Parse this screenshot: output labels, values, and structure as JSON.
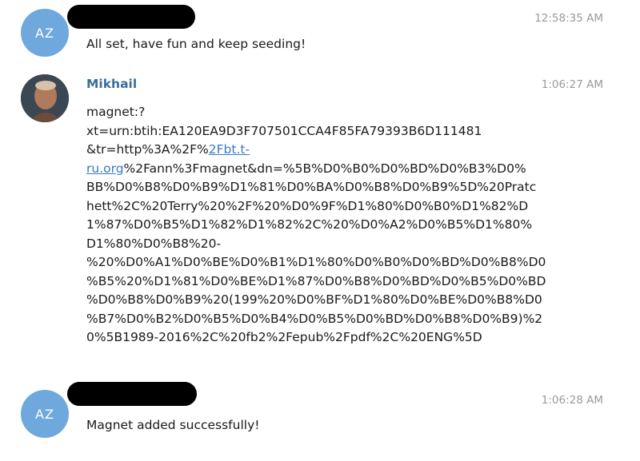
{
  "messages": [
    {
      "avatar_initials": "AZ",
      "sender_redacted": true,
      "time": "12:58:35 AM",
      "text": "All set, have fun and keep seeding!"
    },
    {
      "avatar_type": "photo",
      "sender": "Mikhail",
      "time": "1:06:27 AM",
      "magnet_line1": "magnet:?",
      "magnet_line2": "xt=urn:btih:EA120EA9D3F707501CCA4F85FA79393B6D111481",
      "magnet_line3_prefix": "&tr=http%3A%2F%",
      "magnet_link_part1": "2Fbt.t-",
      "magnet_link_part2": "ru.org",
      "magnet_line4_suffix": "%2Fann%3Fmagnet&dn=%5B%D0%B0%D0%BD%D0%B3%D0%",
      "magnet_rest": [
        "BB%D0%B8%D0%B9%D1%81%D0%BA%D0%B8%D0%B9%5D%20Pratc",
        "hett%2C%20Terry%20%2F%20%D0%9F%D1%80%D0%B0%D1%82%D",
        "1%87%D0%B5%D1%82%D1%82%2C%20%D0%A2%D0%B5%D1%80%",
        "D1%80%D0%B8%20-",
        "%20%D0%A1%D0%BE%D0%B1%D1%80%D0%B0%D0%BD%D0%B8%D0",
        "%B5%20%D1%81%D0%BE%D1%87%D0%B8%D0%BD%D0%B5%D0%BD",
        "%D0%B8%D0%B9%20(199%20%D0%BF%D1%80%D0%BE%D0%B8%D0",
        "%B7%D0%B2%D0%B5%D0%B4%D0%B5%D0%BD%D0%B8%D0%B9)%2",
        "0%5B1989-2016%2C%20fb2%2Fepub%2Fpdf%2C%20ENG%5D"
      ]
    },
    {
      "avatar_initials": "AZ",
      "sender_redacted": true,
      "time": "1:06:28 AM",
      "text": "Magnet added successfully!"
    }
  ]
}
